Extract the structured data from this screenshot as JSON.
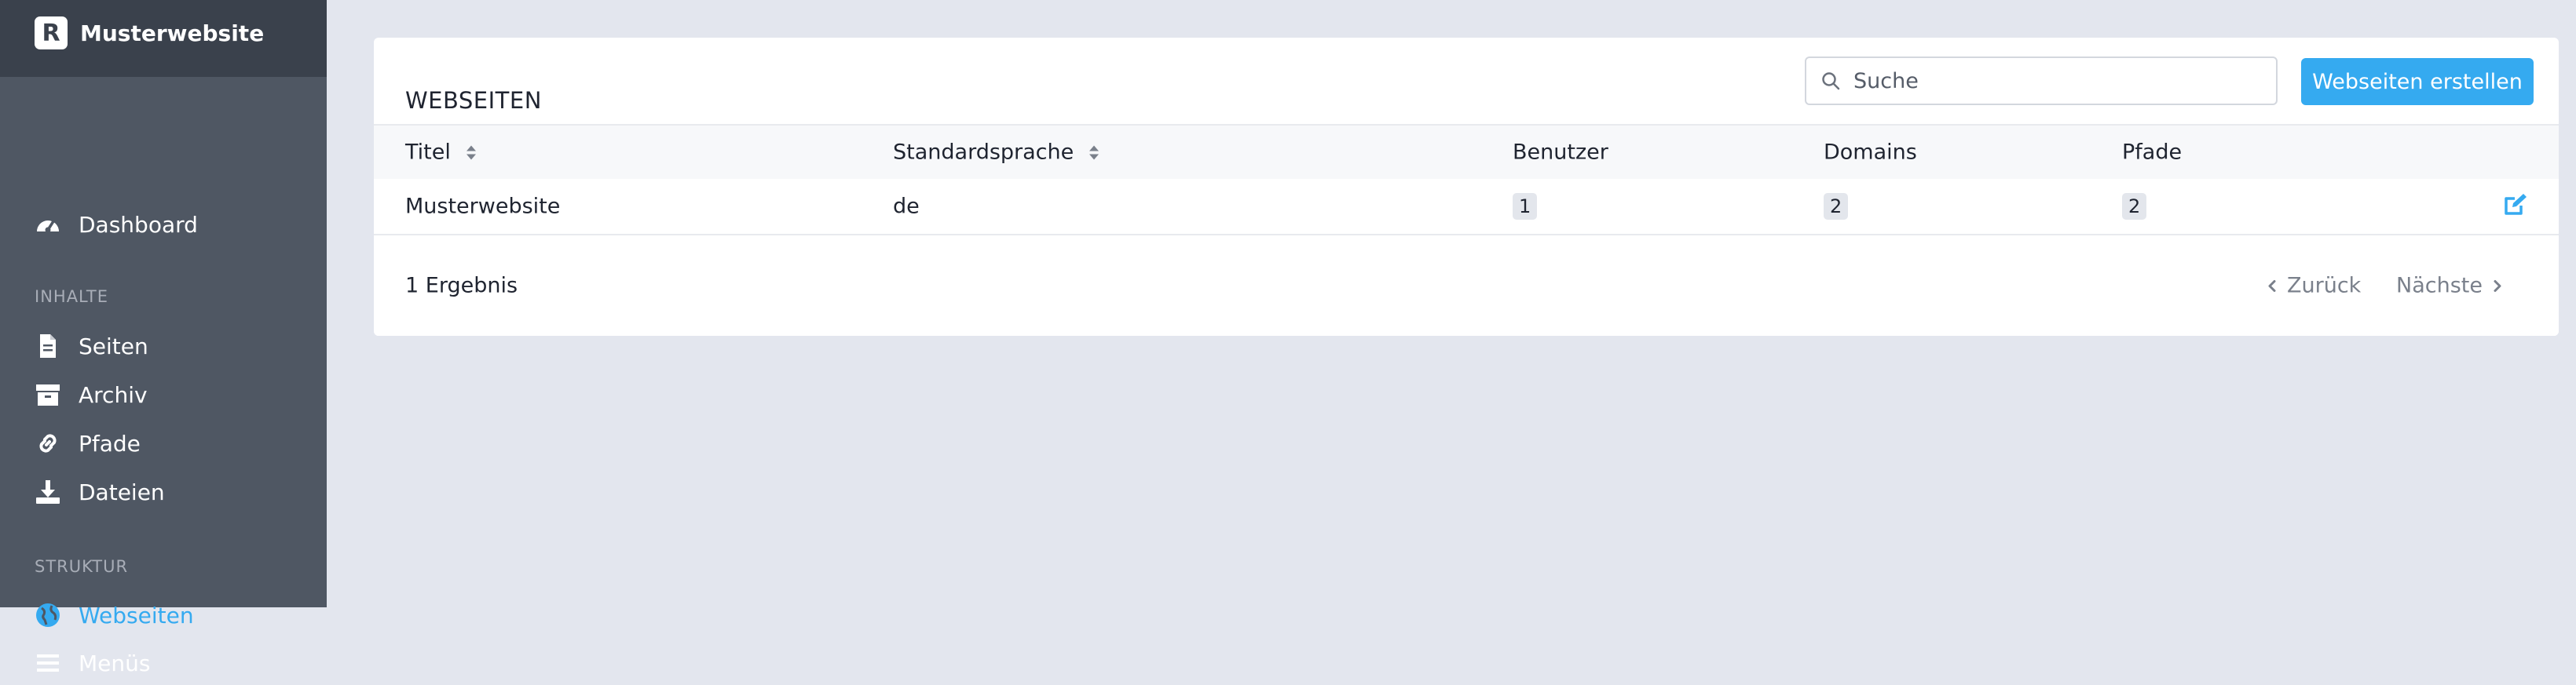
{
  "sidebar": {
    "app_title": "Musterwebsite",
    "logo_letter": "R",
    "items": [
      {
        "label": "Dashboard",
        "icon": "dashboard-gauge-icon"
      },
      {
        "label": "Seiten",
        "icon": "file-icon"
      },
      {
        "label": "Archiv",
        "icon": "archive-icon"
      },
      {
        "label": "Pfade",
        "icon": "link-icon"
      },
      {
        "label": "Dateien",
        "icon": "download-icon"
      },
      {
        "label": "Webseiten",
        "icon": "globe-icon",
        "active": true
      },
      {
        "label": "Menüs",
        "icon": "bars-icon"
      }
    ],
    "sections": {
      "inhalte": "INHALTE",
      "struktur": "STRUKTUR"
    }
  },
  "main": {
    "title": "WEBSEITEN",
    "search": {
      "placeholder": "Suche",
      "value": ""
    },
    "create_button": "Webseiten erstellen",
    "table": {
      "columns": [
        "Titel",
        "Standardsprache",
        "Benutzer",
        "Domains",
        "Pfade"
      ],
      "rows": [
        {
          "title": "Musterwebsite",
          "language": "de",
          "users": "1",
          "domains": "2",
          "paths": "2"
        }
      ]
    },
    "result_count": "1 Ergebnis",
    "pagination": {
      "prev": "Zurück",
      "next": "Nächste"
    }
  },
  "colors": {
    "accent": "#35aaf0",
    "sidebar_bg": "#4f5763",
    "sidebar_header_bg": "#3a414c",
    "page_bg": "#e3e6ee"
  }
}
